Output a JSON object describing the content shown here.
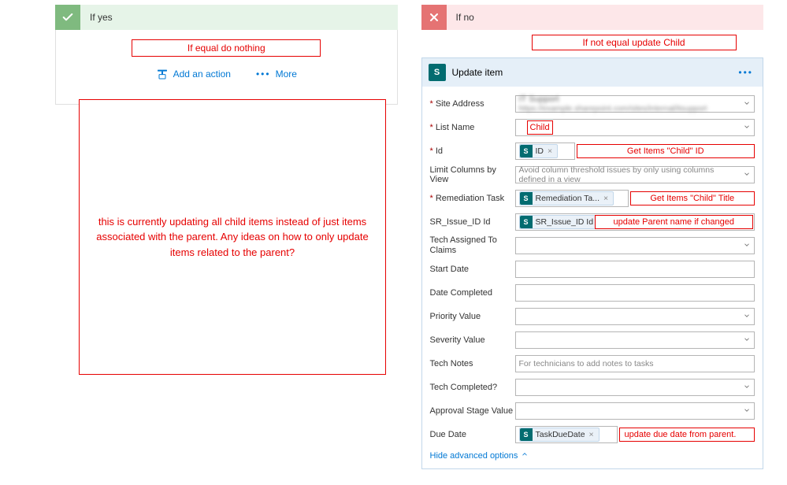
{
  "yes_branch": {
    "label": "If yes",
    "anno": "If equal do nothing",
    "add_action": "Add an action",
    "more": "More"
  },
  "no_branch": {
    "label": "If no",
    "anno": "If not equal update Child"
  },
  "big_anno": "this is currently updating all child items instead of just items associated with the parent.  Any ideas on how to only update items related to the parent?",
  "action": {
    "title": "Update item",
    "hide_adv": "Hide advanced options",
    "fields": {
      "site_address": {
        "label": "Site Address",
        "line1": "IT Support",
        "line2": "https://example.sharepoint.com/sites/internal/itsupport"
      },
      "list_name": {
        "label": "List Name",
        "anno": "Child"
      },
      "id": {
        "label": "Id",
        "token": "ID",
        "anno": "Get Items \"Child\" ID"
      },
      "limit_cols": {
        "label": "Limit Columns by View",
        "placeholder": "Avoid column threshold issues by only using columns defined in a view"
      },
      "remediation": {
        "label": "Remediation Task",
        "token": "Remediation Ta...",
        "anno": "Get Items \"Child\" Title"
      },
      "sr_issue": {
        "label": "SR_Issue_ID Id",
        "token": "SR_Issue_ID Id",
        "anno": "update Parent name if changed"
      },
      "tech_assigned": {
        "label": "Tech Assigned To Claims"
      },
      "start_date": {
        "label": "Start Date"
      },
      "date_completed": {
        "label": "Date Completed"
      },
      "priority": {
        "label": "Priority Value"
      },
      "severity": {
        "label": "Severity Value"
      },
      "tech_notes": {
        "label": "Tech Notes",
        "placeholder": "For technicians to add notes to tasks"
      },
      "tech_completed": {
        "label": "Tech Completed?"
      },
      "approval_stage": {
        "label": "Approval Stage Value"
      },
      "due_date": {
        "label": "Due Date",
        "token": "TaskDueDate",
        "anno": "update due date from parent."
      }
    }
  }
}
